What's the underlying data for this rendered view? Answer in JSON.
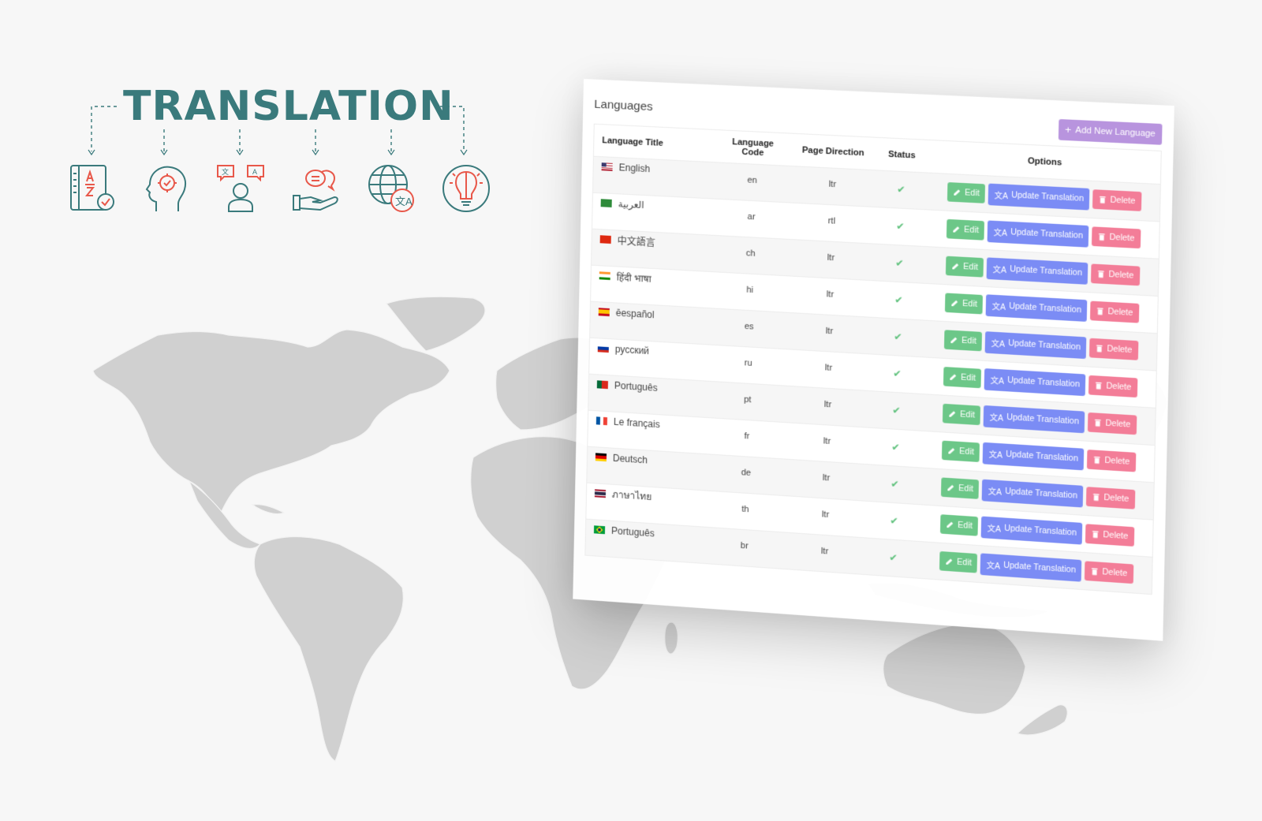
{
  "hero": {
    "title": "TRANSLATION",
    "title_color": "#3a7a7c",
    "accent_color": "#e8584a",
    "icons": [
      {
        "name": "dictionary-az-icon"
      },
      {
        "name": "head-gear-icon"
      },
      {
        "name": "person-speech-bubbles-icon"
      },
      {
        "name": "hand-chat-bubbles-icon"
      },
      {
        "name": "globe-translate-icon"
      },
      {
        "name": "lightbulb-brain-icon"
      }
    ]
  },
  "panel": {
    "title": "Languages",
    "add_button_label": "Add New Language",
    "columns": {
      "title": "Language Title",
      "code": "Language Code",
      "direction": "Page Direction",
      "status": "Status",
      "options": "Options"
    },
    "actions": {
      "edit": "Edit",
      "update": "Update Translation",
      "delete": "Delete"
    },
    "colors": {
      "add": "#b894de",
      "edit": "#6cc788",
      "update": "#7b8cf5",
      "delete": "#f37d98",
      "status_active": "#5cc07a"
    },
    "rows": [
      {
        "flag": "us",
        "title": "English",
        "code": "en",
        "direction": "ltr",
        "status": "✔"
      },
      {
        "flag": "sa",
        "title": "العربية",
        "code": "ar",
        "direction": "rtl",
        "status": "✔"
      },
      {
        "flag": "cn",
        "title": "中文語言",
        "code": "ch",
        "direction": "ltr",
        "status": "✔"
      },
      {
        "flag": "in",
        "title": "हिंदी भाषा",
        "code": "hi",
        "direction": "ltr",
        "status": "✔"
      },
      {
        "flag": "es",
        "title": "ēespañol",
        "code": "es",
        "direction": "ltr",
        "status": "✔"
      },
      {
        "flag": "ru",
        "title": "русский",
        "code": "ru",
        "direction": "ltr",
        "status": "✔"
      },
      {
        "flag": "pt",
        "title": "Português",
        "code": "pt",
        "direction": "ltr",
        "status": "✔"
      },
      {
        "flag": "fr",
        "title": "Le français",
        "code": "fr",
        "direction": "ltr",
        "status": "✔"
      },
      {
        "flag": "de",
        "title": "Deutsch",
        "code": "de",
        "direction": "ltr",
        "status": "✔"
      },
      {
        "flag": "th",
        "title": "ภาษาไทย",
        "code": "th",
        "direction": "ltr",
        "status": "✔"
      },
      {
        "flag": "br",
        "title": "Português",
        "code": "br",
        "direction": "ltr",
        "status": "✔"
      }
    ]
  }
}
